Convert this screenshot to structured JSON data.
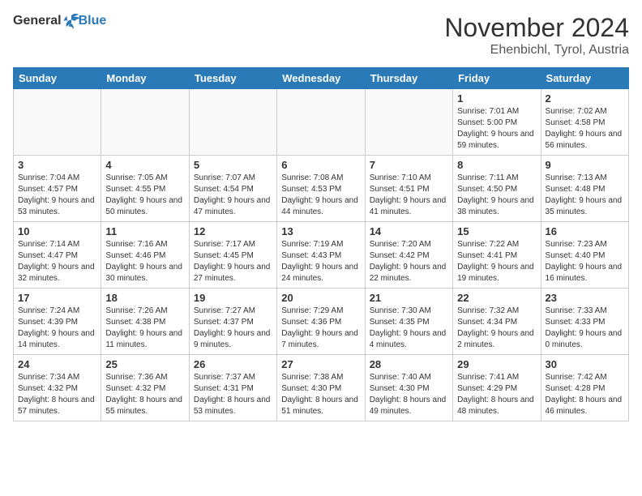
{
  "header": {
    "logo_general": "General",
    "logo_blue": "Blue",
    "title": "November 2024",
    "subtitle": "Ehenbichl, Tyrol, Austria"
  },
  "weekdays": [
    "Sunday",
    "Monday",
    "Tuesday",
    "Wednesday",
    "Thursday",
    "Friday",
    "Saturday"
  ],
  "weeks": [
    [
      {
        "day": "",
        "info": ""
      },
      {
        "day": "",
        "info": ""
      },
      {
        "day": "",
        "info": ""
      },
      {
        "day": "",
        "info": ""
      },
      {
        "day": "",
        "info": ""
      },
      {
        "day": "1",
        "info": "Sunrise: 7:01 AM\nSunset: 5:00 PM\nDaylight: 9 hours and 59 minutes."
      },
      {
        "day": "2",
        "info": "Sunrise: 7:02 AM\nSunset: 4:58 PM\nDaylight: 9 hours and 56 minutes."
      }
    ],
    [
      {
        "day": "3",
        "info": "Sunrise: 7:04 AM\nSunset: 4:57 PM\nDaylight: 9 hours and 53 minutes."
      },
      {
        "day": "4",
        "info": "Sunrise: 7:05 AM\nSunset: 4:55 PM\nDaylight: 9 hours and 50 minutes."
      },
      {
        "day": "5",
        "info": "Sunrise: 7:07 AM\nSunset: 4:54 PM\nDaylight: 9 hours and 47 minutes."
      },
      {
        "day": "6",
        "info": "Sunrise: 7:08 AM\nSunset: 4:53 PM\nDaylight: 9 hours and 44 minutes."
      },
      {
        "day": "7",
        "info": "Sunrise: 7:10 AM\nSunset: 4:51 PM\nDaylight: 9 hours and 41 minutes."
      },
      {
        "day": "8",
        "info": "Sunrise: 7:11 AM\nSunset: 4:50 PM\nDaylight: 9 hours and 38 minutes."
      },
      {
        "day": "9",
        "info": "Sunrise: 7:13 AM\nSunset: 4:48 PM\nDaylight: 9 hours and 35 minutes."
      }
    ],
    [
      {
        "day": "10",
        "info": "Sunrise: 7:14 AM\nSunset: 4:47 PM\nDaylight: 9 hours and 32 minutes."
      },
      {
        "day": "11",
        "info": "Sunrise: 7:16 AM\nSunset: 4:46 PM\nDaylight: 9 hours and 30 minutes."
      },
      {
        "day": "12",
        "info": "Sunrise: 7:17 AM\nSunset: 4:45 PM\nDaylight: 9 hours and 27 minutes."
      },
      {
        "day": "13",
        "info": "Sunrise: 7:19 AM\nSunset: 4:43 PM\nDaylight: 9 hours and 24 minutes."
      },
      {
        "day": "14",
        "info": "Sunrise: 7:20 AM\nSunset: 4:42 PM\nDaylight: 9 hours and 22 minutes."
      },
      {
        "day": "15",
        "info": "Sunrise: 7:22 AM\nSunset: 4:41 PM\nDaylight: 9 hours and 19 minutes."
      },
      {
        "day": "16",
        "info": "Sunrise: 7:23 AM\nSunset: 4:40 PM\nDaylight: 9 hours and 16 minutes."
      }
    ],
    [
      {
        "day": "17",
        "info": "Sunrise: 7:24 AM\nSunset: 4:39 PM\nDaylight: 9 hours and 14 minutes."
      },
      {
        "day": "18",
        "info": "Sunrise: 7:26 AM\nSunset: 4:38 PM\nDaylight: 9 hours and 11 minutes."
      },
      {
        "day": "19",
        "info": "Sunrise: 7:27 AM\nSunset: 4:37 PM\nDaylight: 9 hours and 9 minutes."
      },
      {
        "day": "20",
        "info": "Sunrise: 7:29 AM\nSunset: 4:36 PM\nDaylight: 9 hours and 7 minutes."
      },
      {
        "day": "21",
        "info": "Sunrise: 7:30 AM\nSunset: 4:35 PM\nDaylight: 9 hours and 4 minutes."
      },
      {
        "day": "22",
        "info": "Sunrise: 7:32 AM\nSunset: 4:34 PM\nDaylight: 9 hours and 2 minutes."
      },
      {
        "day": "23",
        "info": "Sunrise: 7:33 AM\nSunset: 4:33 PM\nDaylight: 9 hours and 0 minutes."
      }
    ],
    [
      {
        "day": "24",
        "info": "Sunrise: 7:34 AM\nSunset: 4:32 PM\nDaylight: 8 hours and 57 minutes."
      },
      {
        "day": "25",
        "info": "Sunrise: 7:36 AM\nSunset: 4:32 PM\nDaylight: 8 hours and 55 minutes."
      },
      {
        "day": "26",
        "info": "Sunrise: 7:37 AM\nSunset: 4:31 PM\nDaylight: 8 hours and 53 minutes."
      },
      {
        "day": "27",
        "info": "Sunrise: 7:38 AM\nSunset: 4:30 PM\nDaylight: 8 hours and 51 minutes."
      },
      {
        "day": "28",
        "info": "Sunrise: 7:40 AM\nSunset: 4:30 PM\nDaylight: 8 hours and 49 minutes."
      },
      {
        "day": "29",
        "info": "Sunrise: 7:41 AM\nSunset: 4:29 PM\nDaylight: 8 hours and 48 minutes."
      },
      {
        "day": "30",
        "info": "Sunrise: 7:42 AM\nSunset: 4:28 PM\nDaylight: 8 hours and 46 minutes."
      }
    ]
  ]
}
